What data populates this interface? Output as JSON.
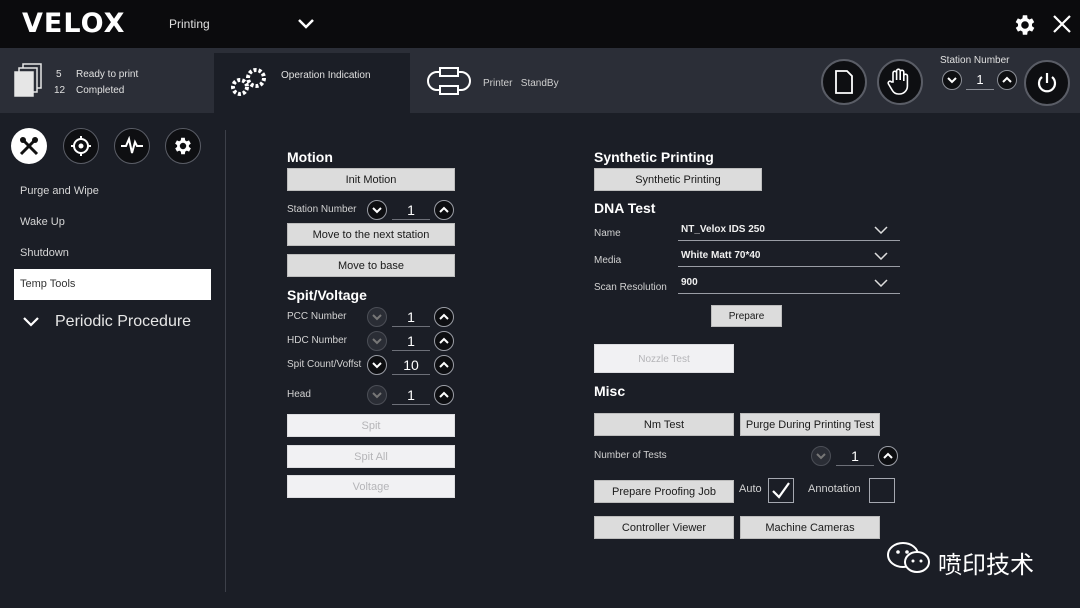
{
  "app": {
    "brand": "VELOX",
    "mode": "Printing"
  },
  "status": {
    "ready_count": "5",
    "ready_label": "Ready to print",
    "completed_count": "12",
    "completed_label": "Completed",
    "active_tab": "Operation Indication",
    "printer_label": "Printer",
    "printer_state": "StandBy"
  },
  "station_top": {
    "label": "Station Number",
    "value": "1"
  },
  "sidebar": {
    "items": [
      "Purge and Wipe",
      "Wake Up",
      "Shutdown",
      "Temp Tools"
    ],
    "selected": "Temp Tools",
    "section": "Periodic Procedure"
  },
  "motion": {
    "title": "Motion",
    "init_btn": "Init Motion",
    "station_label": "Station Number",
    "station_value": "1",
    "next_btn": "Move to the next station",
    "base_btn": "Move to base"
  },
  "spit": {
    "title": "Spit/Voltage",
    "pcc_label": "PCC Number",
    "pcc_value": "1",
    "hdc_label": "HDC Number",
    "hdc_value": "1",
    "spitcount_label": "Spit Count/Voffst",
    "spitcount_value": "10",
    "head_label": "Head",
    "head_value": "1",
    "spit_btn": "Spit",
    "spitall_btn": "Spit All",
    "voltage_btn": "Voltage"
  },
  "synthetic": {
    "title": "Synthetic Printing",
    "btn": "Synthetic Printing"
  },
  "dna": {
    "title": "DNA Test",
    "name_label": "Name",
    "name_value": "NT_Velox IDS 250",
    "media_label": "Media",
    "media_value": "White Matt 70*40",
    "res_label": "Scan Resolution",
    "res_value": "900",
    "prepare_btn": "Prepare",
    "nozzle_btn": "Nozzle Test"
  },
  "misc": {
    "title": "Misc",
    "nm_btn": "Nm Test",
    "purge_btn": "Purge During Printing Test",
    "tests_label": "Number of Tests",
    "tests_value": "1",
    "proof_btn": "Prepare Proofing Job",
    "auto_label": "Auto",
    "auto_checked": true,
    "annotation_label": "Annotation",
    "annotation_checked": false,
    "controller_btn": "Controller Viewer",
    "cameras_btn": "Machine Cameras"
  },
  "watermark": "喷印技术"
}
